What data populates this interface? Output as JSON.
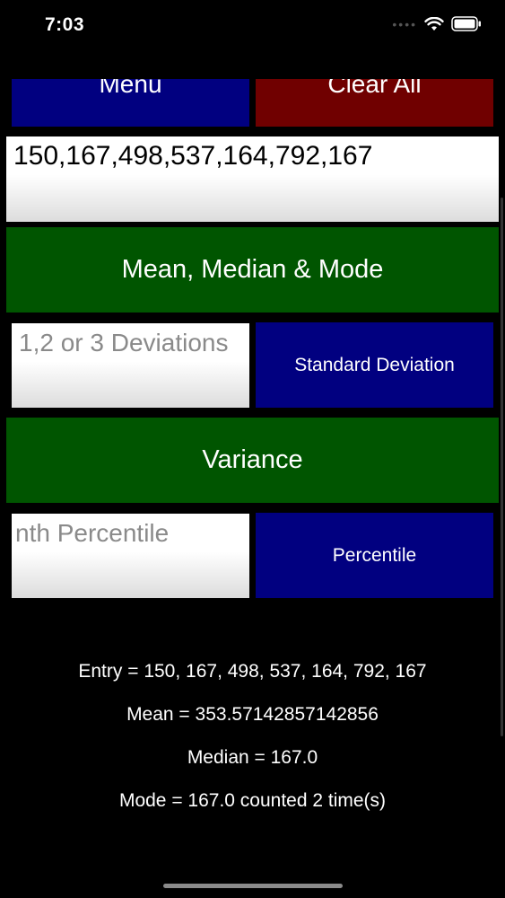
{
  "status": {
    "time": "7:03"
  },
  "top_buttons": {
    "menu_label": "Menu",
    "clear_label": "Clear All"
  },
  "entry_input": {
    "value": "150,167,498,537,164,792,167"
  },
  "mmm_button": {
    "label": "Mean, Median & Mode"
  },
  "deviation_input": {
    "placeholder": "1,2 or 3 Deviations"
  },
  "std_button": {
    "label": "Standard Deviation"
  },
  "variance_button": {
    "label": "Variance"
  },
  "percentile_input": {
    "placeholder": "nth Percentile"
  },
  "percentile_button": {
    "label": "Percentile"
  },
  "results": {
    "entry": "Entry = 150, 167, 498, 537, 164, 792, 167",
    "mean": "Mean = 353.57142857142856",
    "median": "Median = 167.0",
    "mode": "Mode = 167.0 counted 2 time(s)"
  },
  "colors": {
    "blue": "#010080",
    "red": "#700000",
    "green": "#005500"
  }
}
